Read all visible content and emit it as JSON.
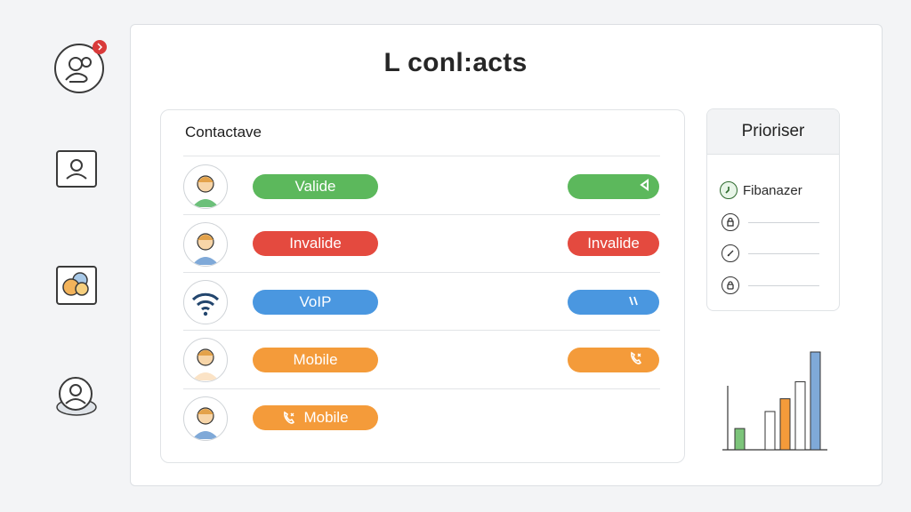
{
  "page": {
    "title": "L conl:acts"
  },
  "contacts": {
    "title": "Contactave",
    "rows": [
      {
        "left_label": "Valide",
        "right_label": "",
        "color": "#5cb85c",
        "right_icon": "play-back-icon",
        "avatar": "person-avatar-green"
      },
      {
        "left_label": "Invalide",
        "right_label": "Invalide",
        "color": "#e44a3f",
        "right_icon": "",
        "avatar": "person-avatar-blue"
      },
      {
        "left_label": "VoIP",
        "right_label": "",
        "color": "#4a97e0",
        "right_icon": "signal-slash-icon",
        "avatar": "wifi-avatar"
      },
      {
        "left_label": "Mobile",
        "right_label": "",
        "color": "#f49b3a",
        "right_icon": "phone-icon",
        "avatar": "person-avatar-light"
      },
      {
        "left_label": "Mobile",
        "right_label": "",
        "color": "#f49b3a",
        "left_icon": "phone-icon",
        "avatar": "person-avatar-blue"
      }
    ]
  },
  "side_panel": {
    "title": "Prioriser",
    "items": [
      {
        "icon": "clock-icon",
        "label": "Fibanazer"
      },
      {
        "icon": "lock-icon",
        "label": ""
      },
      {
        "icon": "compass-icon",
        "label": ""
      },
      {
        "icon": "padlock-icon",
        "label": ""
      }
    ]
  },
  "chart_data": {
    "type": "bar",
    "categories": [
      "",
      "",
      "",
      "",
      "",
      ""
    ],
    "series": [
      {
        "values": [
          25,
          0,
          45,
          60,
          80,
          115
        ]
      }
    ],
    "colors": [
      "#7cc47a",
      "#ffffff",
      "#ffffff",
      "#f49b3a",
      "#ffffff",
      "#7fa9d8"
    ],
    "title": "",
    "xlabel": "",
    "ylabel": ""
  }
}
